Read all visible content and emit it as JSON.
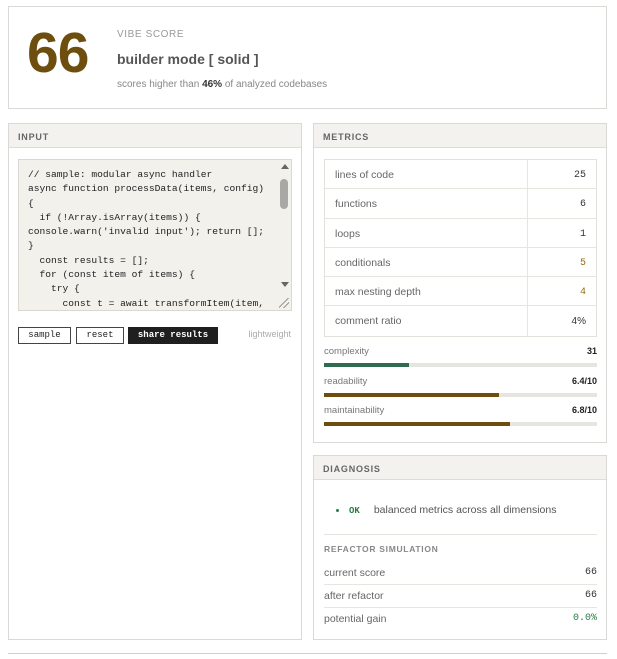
{
  "score": {
    "value": "66",
    "label": "VIBE SCORE",
    "mode": "builder mode [ solid ]",
    "percentile_prefix": "scores higher than ",
    "percentile_value": "46%",
    "percentile_suffix": " of analyzed codebases",
    "color": "#6d4e0e"
  },
  "input": {
    "heading": "INPUT",
    "code": "// sample: modular async handler\nasync function processData(items, config)\n{\n  if (!Array.isArray(items)) {\nconsole.warn('invalid input'); return [];\n}\n  const results = [];\n  for (const item of items) {\n    try {\n      const t = await transformItem(item,",
    "buttons": {
      "sample": "sample",
      "reset": "reset",
      "share": "share results"
    },
    "tag": "lightweight"
  },
  "metrics": {
    "heading": "METRICS",
    "rows": [
      {
        "name": "lines of code",
        "value": "25"
      },
      {
        "name": "functions",
        "value": "6"
      },
      {
        "name": "loops",
        "value": "1"
      },
      {
        "name": "conditionals",
        "value": "5"
      },
      {
        "name": "max nesting depth",
        "value": "4"
      },
      {
        "name": "comment ratio",
        "value": "4%"
      }
    ],
    "bars": [
      {
        "label": "complexity",
        "value": "31",
        "fraction": 0.31,
        "color": "#2f6b4f"
      },
      {
        "label": "readability",
        "value": "6.4/10",
        "fraction": 0.64,
        "color": "#6d4e0e"
      },
      {
        "label": "maintainability",
        "value": "6.8/10",
        "fraction": 0.68,
        "color": "#6d4e0e"
      }
    ]
  },
  "diagnosis": {
    "heading": "DIAGNOSIS",
    "status": "OK",
    "message": "balanced metrics across all dimensions",
    "sim_heading": "REFACTOR SIMULATION",
    "rows": [
      {
        "name": "current score",
        "value": "66"
      },
      {
        "name": "after refactor",
        "value": "66"
      },
      {
        "name": "potential gain",
        "value": "0.0%"
      }
    ]
  }
}
